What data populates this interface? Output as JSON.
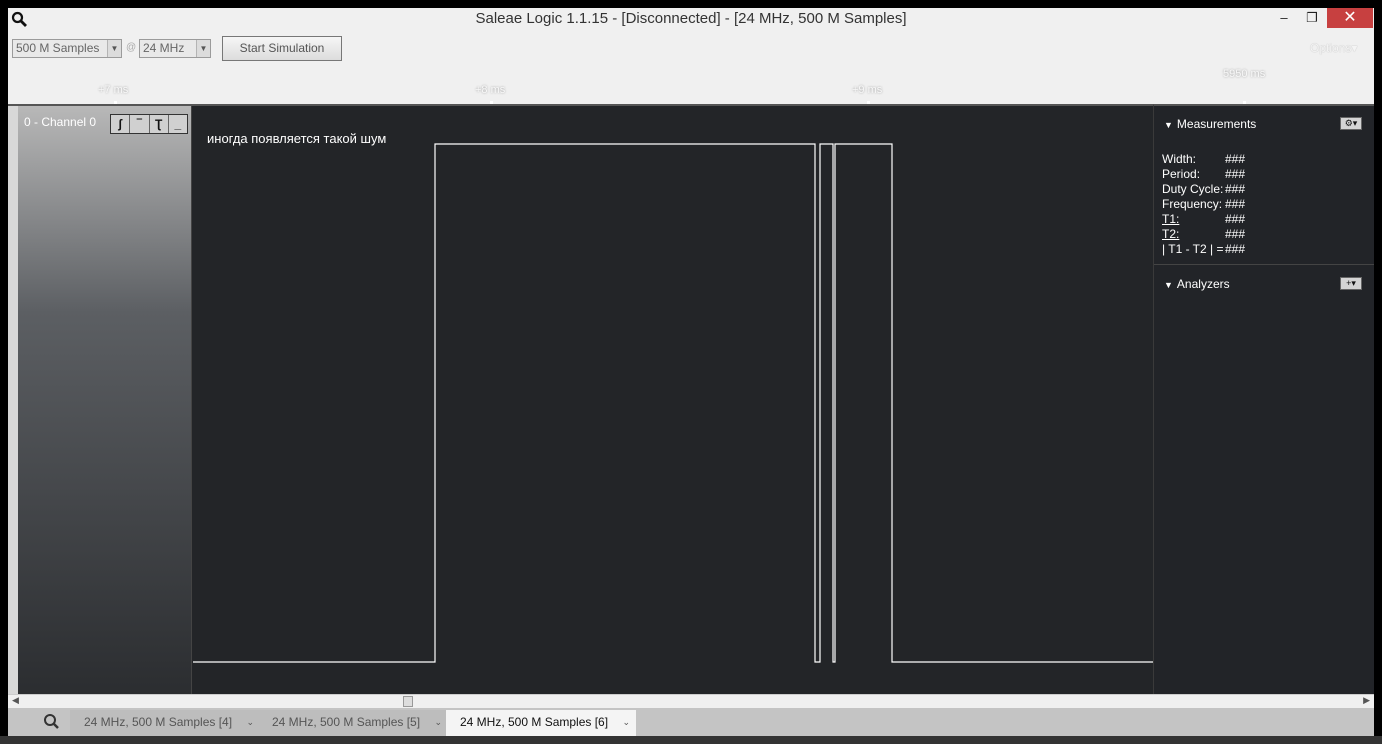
{
  "window": {
    "title": "Saleae Logic 1.1.15 - [Disconnected] - [24 MHz, 500 M Samples]",
    "minimize": "–",
    "maximize": "❐",
    "close": "✕"
  },
  "toolbar": {
    "samples": "500 M Samples",
    "at": "@",
    "rate": "24 MHz",
    "start": "Start Simulation",
    "options": "Options▾"
  },
  "ruler": {
    "t1": "+7 ms",
    "t2": "+8 ms",
    "t3": "+9 ms",
    "t4": "5950 ms"
  },
  "channel": {
    "name": "0 - Channel 0",
    "triggers": [
      "ʃ",
      "‾",
      "Ʈ",
      "_"
    ]
  },
  "annotation": "иногда появляется такой шум",
  "measurements": {
    "title": "Measurements",
    "gear": "⚙▾",
    "rows": [
      {
        "k": "Width:",
        "v": "###"
      },
      {
        "k": "Period:",
        "v": "###"
      },
      {
        "k": "Duty Cycle:",
        "v": "###"
      },
      {
        "k": "Frequency:",
        "v": "###"
      },
      {
        "k": "T1:",
        "v": "###"
      },
      {
        "k": "T2:",
        "v": "###"
      },
      {
        "k": "| T1 - T2 | =",
        "v": "###"
      }
    ]
  },
  "analyzers": {
    "title": "Analyzers",
    "add": "+▾"
  },
  "tabs": [
    "24 MHz, 500 M Samples [4]",
    "24 MHz, 500 M Samples [5]",
    "24 MHz, 500 M Samples [6]"
  ],
  "colors": {
    "plot_bg": "#232528",
    "signal": "#ffffff",
    "close_btn": "#c74040"
  }
}
